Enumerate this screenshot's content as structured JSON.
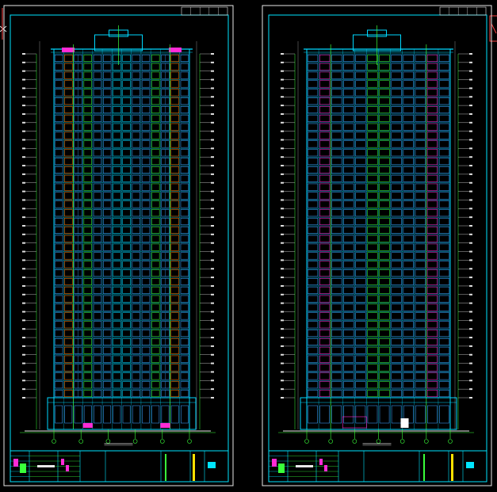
{
  "viewport": {
    "background": "#000000"
  },
  "colors": {
    "frame": "#e8e8e8",
    "border": "#00e5ff",
    "facade": "#00d8ff",
    "window": "#3aa0ff",
    "accent_green": "#39ff3a",
    "accent_magenta": "#ff2bd6",
    "accent_orange": "#ff7a00",
    "text": "#e0e0e0",
    "yellow": "#ffe100",
    "bg": "#000000"
  },
  "sheets": [
    {
      "id": "left",
      "title_glyph": "",
      "floors": 40
    },
    {
      "id": "right",
      "title_glyph": "",
      "floors": 40
    }
  ],
  "icons": {
    "crosshair": "crosshair-icon",
    "north": "north-arrow-icon"
  }
}
